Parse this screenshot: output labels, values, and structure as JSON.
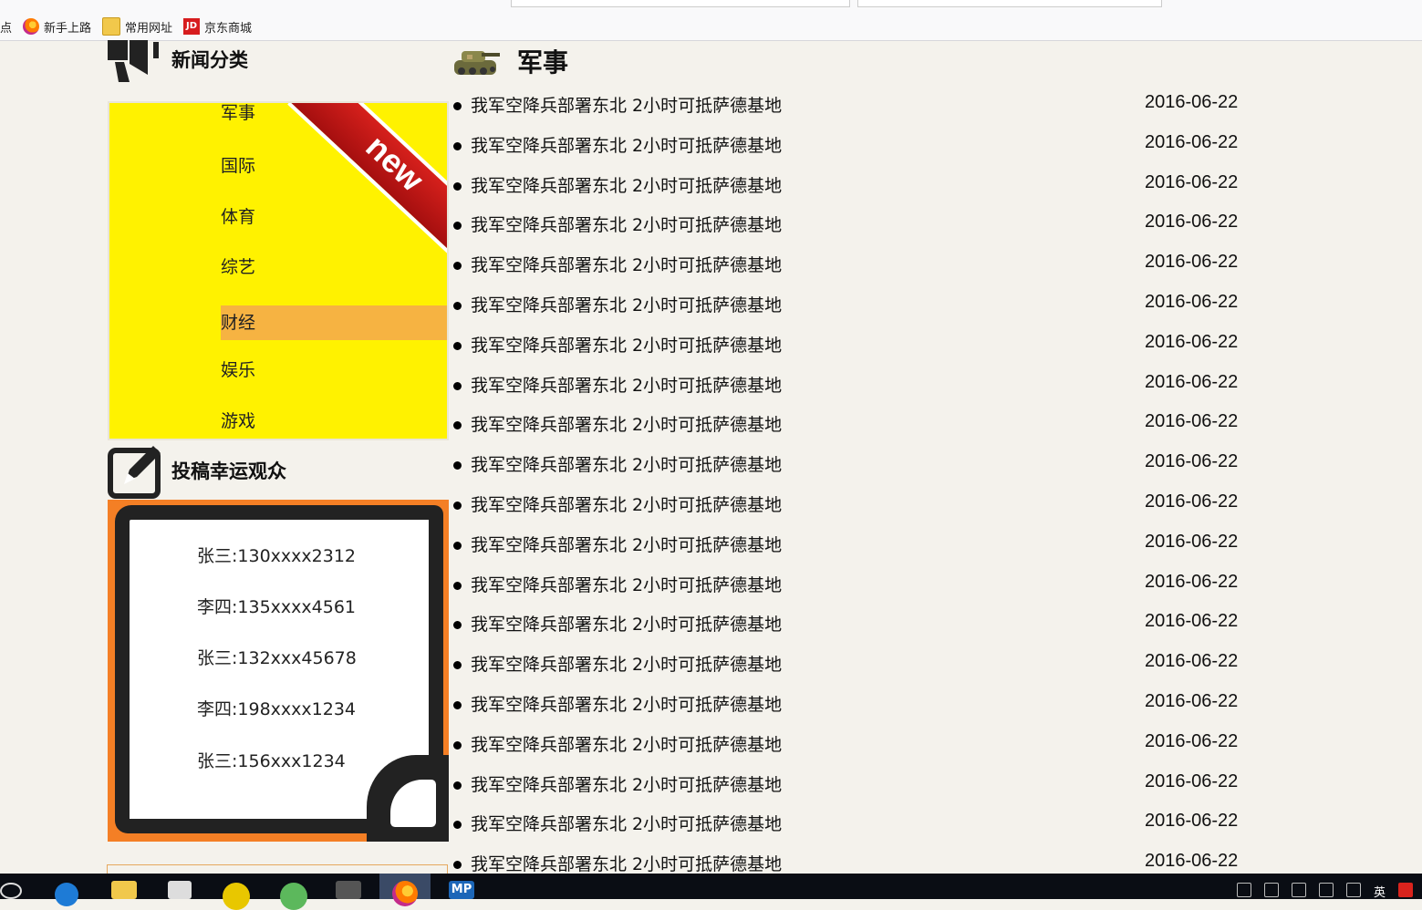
{
  "bookmarks": {
    "cut_text": "点",
    "items": [
      {
        "label": "新手上路",
        "icon": "firefox-icon"
      },
      {
        "label": "常用网址",
        "icon": "folder-icon"
      },
      {
        "label": "京东商城",
        "icon": "jd-icon",
        "icon_text": "JD"
      }
    ]
  },
  "sidebar": {
    "news_category_title": "新闻分类",
    "categories": [
      "军事",
      "国际",
      "体育",
      "综艺",
      "财经",
      "娱乐",
      "游戏"
    ],
    "active_category": "财经",
    "ribbon_text": "new",
    "lucky_title": "投稿幸运观众",
    "lucky_list": [
      "张三:130xxxx2312",
      "李四:135xxxx4561",
      "张三:132xxx45678",
      "李四:198xxxx1234",
      "张三:156xxx1234"
    ]
  },
  "main": {
    "section_title": "军事",
    "news": [
      {
        "title": "我军空降兵部署东北 2小时可抵萨德基地",
        "date": "2016-06-22"
      },
      {
        "title": "我军空降兵部署东北 2小时可抵萨德基地",
        "date": "2016-06-22"
      },
      {
        "title": "我军空降兵部署东北 2小时可抵萨德基地",
        "date": "2016-06-22"
      },
      {
        "title": "我军空降兵部署东北 2小时可抵萨德基地",
        "date": "2016-06-22"
      },
      {
        "title": "我军空降兵部署东北 2小时可抵萨德基地",
        "date": "2016-06-22"
      },
      {
        "title": "我军空降兵部署东北 2小时可抵萨德基地",
        "date": "2016-06-22"
      },
      {
        "title": "我军空降兵部署东北 2小时可抵萨德基地",
        "date": "2016-06-22"
      },
      {
        "title": "我军空降兵部署东北 2小时可抵萨德基地",
        "date": "2016-06-22"
      },
      {
        "title": "我军空降兵部署东北 2小时可抵萨德基地",
        "date": "2016-06-22"
      },
      {
        "title": "我军空降兵部署东北 2小时可抵萨德基地",
        "date": "2016-06-22"
      },
      {
        "title": "我军空降兵部署东北 2小时可抵萨德基地",
        "date": "2016-06-22"
      },
      {
        "title": "我军空降兵部署东北 2小时可抵萨德基地",
        "date": "2016-06-22"
      },
      {
        "title": "我军空降兵部署东北 2小时可抵萨德基地",
        "date": "2016-06-22"
      },
      {
        "title": "我军空降兵部署东北 2小时可抵萨德基地",
        "date": "2016-06-22"
      },
      {
        "title": "我军空降兵部署东北 2小时可抵萨德基地",
        "date": "2016-06-22"
      },
      {
        "title": "我军空降兵部署东北 2小时可抵萨德基地",
        "date": "2016-06-22"
      },
      {
        "title": "我军空降兵部署东北 2小时可抵萨德基地",
        "date": "2016-06-22"
      },
      {
        "title": "我军空降兵部署东北 2小时可抵萨德基地",
        "date": "2016-06-22"
      },
      {
        "title": "我军空降兵部署东北 2小时可抵萨德基地",
        "date": "2016-06-22"
      },
      {
        "title": "我军空降兵部署东北 2小时可抵萨德基地",
        "date": "2016-06-22"
      }
    ]
  },
  "taskbar": {
    "mp_label": "MP",
    "ime_label": "英",
    "apps": [
      "start-icon",
      "edge-icon",
      "file-explorer-icon",
      "store-icon",
      "app-green-icon",
      "app-green2-icon",
      "sublime-icon",
      "firefox-icon",
      "mp-icon"
    ]
  },
  "colors": {
    "category_bg": "#fff200",
    "category_active": "#f6b342",
    "paper_bg": "#f47f25",
    "ribbon": "#c4161c",
    "page_bg": "#f4f2ec"
  }
}
